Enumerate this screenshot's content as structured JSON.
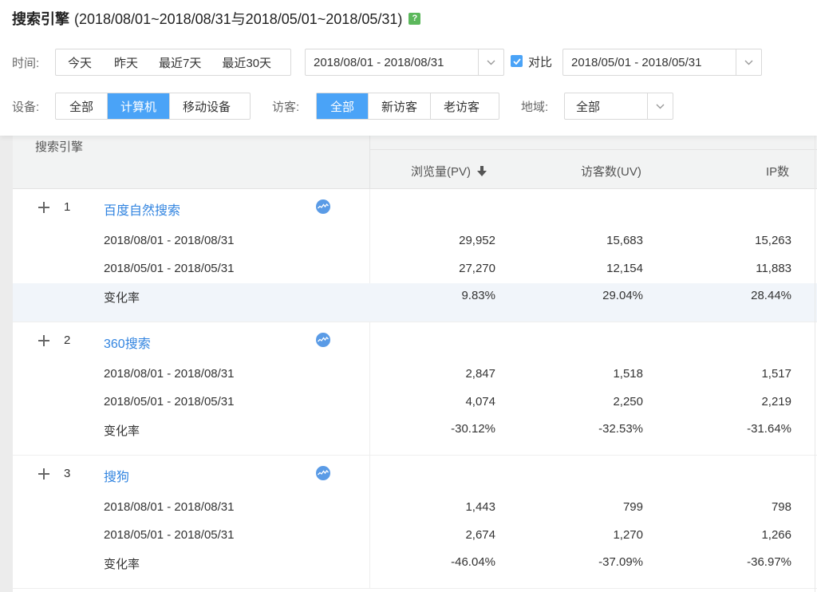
{
  "header": {
    "title": "搜索引擎",
    "range_text": "(2018/08/01~2018/08/31与2018/05/01~2018/05/31)",
    "help_icon": "?"
  },
  "filters": {
    "time": {
      "label": "时间:",
      "options": [
        "今天",
        "昨天",
        "最近7天",
        "最近30天"
      ],
      "date_range": "2018/08/01 - 2018/08/31",
      "compare_label": "对比",
      "compare_checked": true,
      "compare_range": "2018/05/01 - 2018/05/31"
    },
    "device": {
      "label": "设备:",
      "options": [
        "全部",
        "计算机",
        "移动设备"
      ],
      "selected": "计算机"
    },
    "visitor": {
      "label": "访客:",
      "options": [
        "全部",
        "新访客",
        "老访客"
      ],
      "selected": "全部"
    },
    "region": {
      "label": "地域:",
      "value": "全部"
    }
  },
  "table": {
    "columns": {
      "engine": "搜索引擎",
      "pv": "浏览量(PV)",
      "uv": "访客数(UV)",
      "ip": "IP数"
    },
    "sort": {
      "column": "pv",
      "direction": "desc",
      "icon": "arrow-down-icon"
    },
    "rows": [
      {
        "rank": "1",
        "name": "百度自然搜索",
        "current": {
          "label": "2018/08/01 - 2018/08/31",
          "pv": "29,952",
          "uv": "15,683",
          "ip": "15,263"
        },
        "previous": {
          "label": "2018/05/01 - 2018/05/31",
          "pv": "27,270",
          "uv": "12,154",
          "ip": "11,883"
        },
        "change": {
          "label": "变化率",
          "pv": "9.83%",
          "uv": "29.04%",
          "ip": "28.44%"
        }
      },
      {
        "rank": "2",
        "name": "360搜索",
        "current": {
          "label": "2018/08/01 - 2018/08/31",
          "pv": "2,847",
          "uv": "1,518",
          "ip": "1,517"
        },
        "previous": {
          "label": "2018/05/01 - 2018/05/31",
          "pv": "4,074",
          "uv": "2,250",
          "ip": "2,219"
        },
        "change": {
          "label": "变化率",
          "pv": "-30.12%",
          "uv": "-32.53%",
          "ip": "-31.64%"
        }
      },
      {
        "rank": "3",
        "name": "搜狗",
        "current": {
          "label": "2018/08/01 - 2018/08/31",
          "pv": "1,443",
          "uv": "799",
          "ip": "798"
        },
        "previous": {
          "label": "2018/05/01 - 2018/05/31",
          "pv": "2,674",
          "uv": "1,270",
          "ip": "1,266"
        },
        "change": {
          "label": "变化率",
          "pv": "-46.04%",
          "uv": "-37.09%",
          "ip": "-36.97%"
        }
      }
    ]
  },
  "colors": {
    "accent": "#4aa3f7",
    "link": "#3385e0",
    "help": "#5cb85c",
    "highlight_row": "#f1f5fa"
  }
}
